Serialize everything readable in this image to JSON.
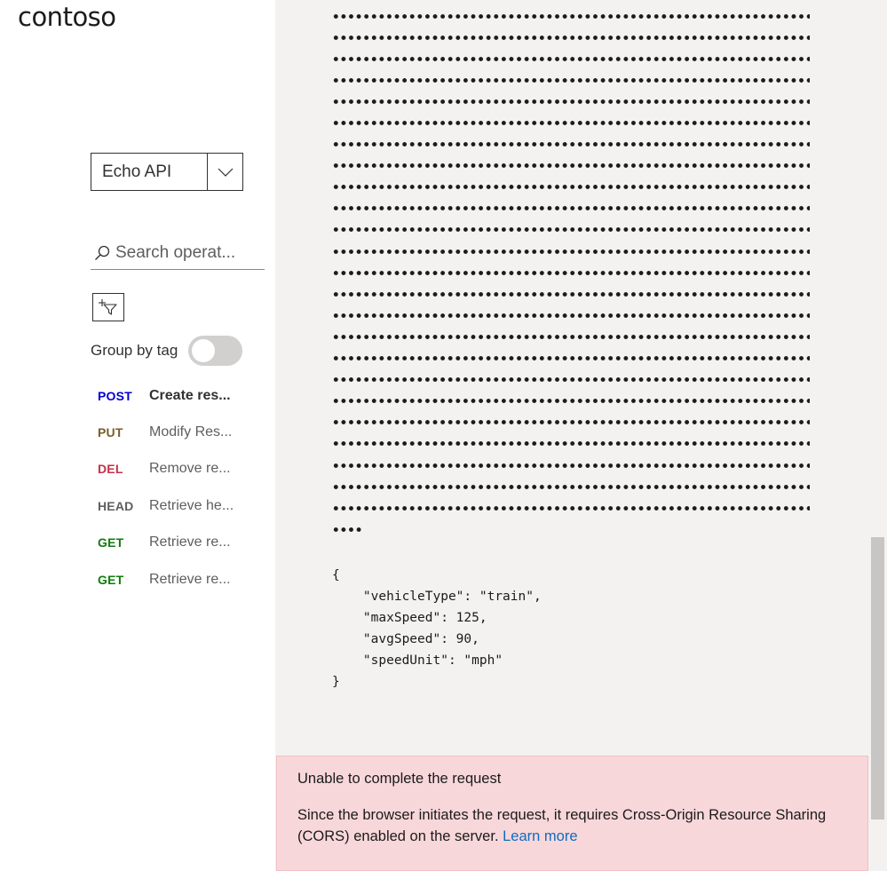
{
  "brand": {
    "logo_text": "contoso"
  },
  "sidebar": {
    "api_selector": {
      "value": "Echo API"
    },
    "search": {
      "placeholder": "Search operat..."
    },
    "group_by_tag": {
      "label": "Group by tag",
      "enabled": false
    },
    "operations": [
      {
        "method": "POST",
        "name": "Create res...",
        "color": "#0000cd",
        "active": true
      },
      {
        "method": "PUT",
        "name": "Modify Res...",
        "color": "#795e26",
        "active": false
      },
      {
        "method": "DEL",
        "name": "Remove re...",
        "color": "#c4314b",
        "active": false
      },
      {
        "method": "HEAD",
        "name": "Retrieve he...",
        "color": "#605e5c",
        "active": false
      },
      {
        "method": "GET",
        "name": "Retrieve re...",
        "color": "#107c10",
        "active": false
      },
      {
        "method": "GET",
        "name": "Retrieve re...",
        "color": "#107c10",
        "active": false
      }
    ]
  },
  "request_body": {
    "masked_rows": 24,
    "masked_tail": "••••",
    "json_text": "{\n    \"vehicleType\": \"train\",\n    \"maxSpeed\": 125,\n    \"avgSpeed\": 90,\n    \"speedUnit\": \"mph\"\n}"
  },
  "error": {
    "title": "Unable to complete the request",
    "message": "Since the browser initiates the request, it requires Cross-Origin Resource Sharing (CORS) enabled on the server.",
    "link_text": "Learn more"
  },
  "colors": {
    "error_bg": "#f8d7da",
    "link": "#0f6cbd",
    "panel_bg": "#f3f2f1"
  }
}
